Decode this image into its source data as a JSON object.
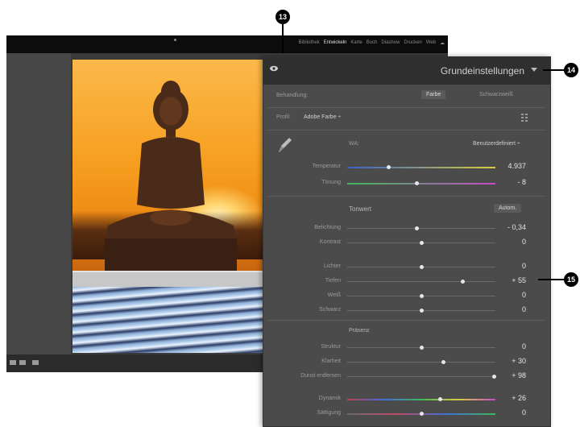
{
  "callouts": {
    "c13": "13",
    "c14": "14",
    "c15": "15"
  },
  "topbar": {
    "modules": [
      "Bibliothek",
      "Entwickeln",
      "Karte",
      "Buch",
      "Diashow",
      "Drucken",
      "Web"
    ],
    "active_index": 1
  },
  "panel": {
    "title": "Grundeinstellungen",
    "treatment": {
      "label": "Behandlung:",
      "color_button": "Farbe",
      "bw_button": "Schwarzweiß"
    },
    "profile": {
      "label": "Profil:",
      "value": "Adobe Farbe ÷"
    },
    "wb": {
      "label": "WA:",
      "value": "Benutzerdefiniert ÷"
    },
    "sliders": [
      {
        "label": "Temperatur",
        "value": "4.937",
        "pos": 0.28
      },
      {
        "label": "Tönung",
        "value": "- 8",
        "pos": 0.47
      }
    ],
    "tone": {
      "title": "Tonwert",
      "auto": "Autom.",
      "sliders": [
        {
          "label": "Belichtung",
          "value": "- 0,34",
          "pos": 0.47
        },
        {
          "label": "Kontrast",
          "value": "0",
          "pos": 0.5
        },
        {
          "label": "Lichter",
          "value": "0",
          "pos": 0.5
        },
        {
          "label": "Tiefen",
          "value": "+ 55",
          "pos": 0.78
        },
        {
          "label": "Weiß",
          "value": "0",
          "pos": 0.5
        },
        {
          "label": "Schwarz",
          "value": "0",
          "pos": 0.5
        }
      ]
    },
    "presence": {
      "title": "Präsenz",
      "sliders": [
        {
          "label": "Struktur",
          "value": "0",
          "pos": 0.5
        },
        {
          "label": "Klarheit",
          "value": "+ 30",
          "pos": 0.65
        },
        {
          "label": "Dunst entfernen",
          "value": "+ 98",
          "pos": 0.99
        },
        {
          "label": "Dynamik",
          "value": "+ 26",
          "pos": 0.63
        },
        {
          "label": "Sättigung",
          "value": "0",
          "pos": 0.5
        }
      ]
    }
  },
  "colors": {
    "panel": "#4b4b4b",
    "header": "#2f2f2f",
    "topbar": "#0c0c0c"
  }
}
